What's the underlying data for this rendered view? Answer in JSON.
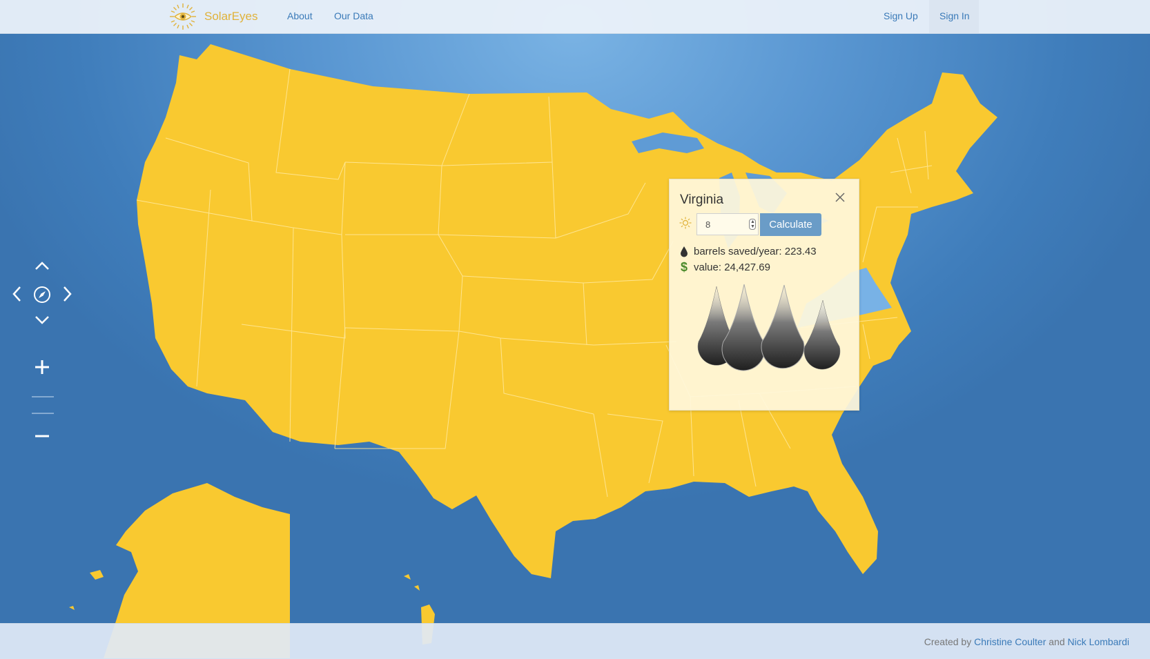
{
  "navbar": {
    "brand": "SolarEyes",
    "links": [
      {
        "label": "About"
      },
      {
        "label": "Our Data"
      }
    ],
    "sign_up": "Sign Up",
    "sign_in": "Sign In"
  },
  "map_controls": {
    "pan_up": "chevron-up-icon",
    "pan_left": "chevron-left-icon",
    "pan_right": "chevron-right-icon",
    "pan_down": "chevron-down-icon",
    "compass": "compass-icon",
    "zoom_in": "plus-icon",
    "zoom_out": "minus-icon"
  },
  "popup": {
    "state_name": "Virginia",
    "hours_value": "8",
    "calculate_label": "Calculate",
    "barrels_text": "barrels saved/year: 223.43",
    "value_text": "value: 24,427.69",
    "barrel_drops_count": 4
  },
  "footer": {
    "created_by": "Created by",
    "author1": "Christine Coulter",
    "and": "and",
    "author2": "Nick Lombardi"
  },
  "colors": {
    "ocean": "#3f7dbb",
    "land": "#f9c930",
    "highlight_state": "#78b2e6",
    "brand": "#e0b23a",
    "link": "#3a7ab8",
    "calculate_button": "#6a9cc7"
  }
}
